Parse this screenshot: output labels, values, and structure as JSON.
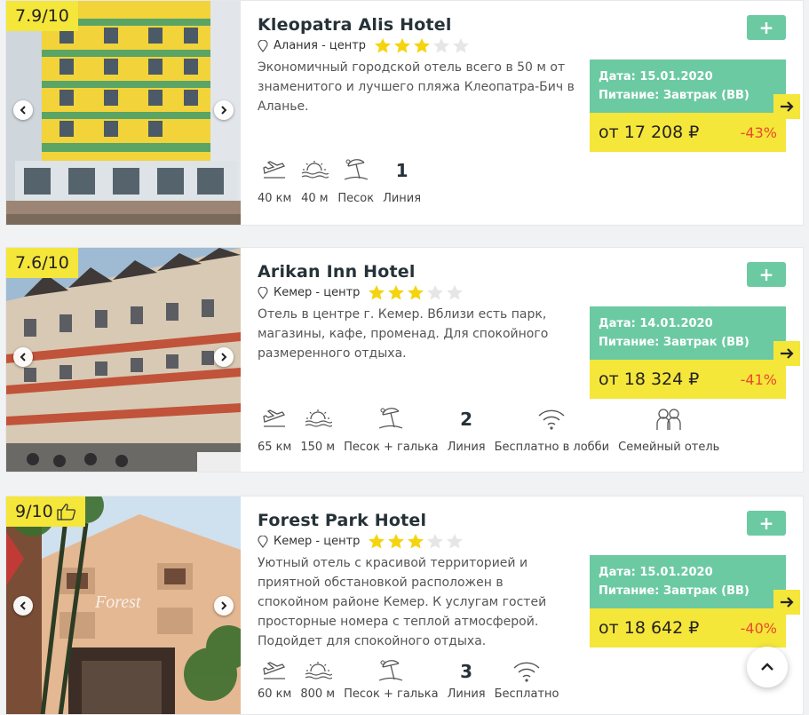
{
  "hotels": [
    {
      "rating": "7.9/10",
      "name": "Kleopatra Alis Hotel",
      "location": "Алания - центр",
      "stars": 3,
      "description": "Экономичный городской отель всего в 50 м от знаменитого и лучшего пляжа Клеопатра-Бич в Аланье.",
      "features": {
        "airport": "40 км",
        "beach": "40 м",
        "beach_type": "Песок",
        "line_num": "1",
        "line_label": "Линия"
      },
      "date": "Дата: 15.01.2020",
      "meal": "Питание: Завтрак (BB)",
      "price": "от 17 208 ₽",
      "discount": "-43%"
    },
    {
      "rating": "7.6/10",
      "name": "Arikan Inn Hotel",
      "location": "Кемер - центр",
      "stars": 3,
      "description": "Отель в центре г. Кемер. Вблизи есть парк, магазины, кафе, променад. Для спокойного размеренного отдыха.",
      "features": {
        "airport": "65 км",
        "beach": "150 м",
        "beach_type": "Песок + галька",
        "line_num": "2",
        "line_label": "Линия",
        "wifi": "Бесплатно в лобби",
        "family": "Семейный отель"
      },
      "date": "Дата: 14.01.2020",
      "meal": "Питание: Завтрак (BB)",
      "price": "от 18 324 ₽",
      "discount": "-41%"
    },
    {
      "rating": "9/10",
      "name": "Forest Park Hotel",
      "location": "Кемер - центр",
      "stars": 3,
      "description": "Уютный отель с красивой территорией и приятной обстановкой расположен в спокойном районе Кемер. К услугам гостей просторные номера с теплой атмосферой. Подойдет для спокойного отдыха.",
      "features": {
        "airport": "60 км",
        "beach": "800 м",
        "beach_type": "Песок + галька",
        "line_num": "3",
        "line_label": "Линия",
        "wifi": "Бесплатно"
      },
      "date": "Дата: 15.01.2020",
      "meal": "Питание: Завтрак (BB)",
      "price": "от 18 642 ₽",
      "discount": "-40%"
    }
  ],
  "add_label": "+",
  "colors": {
    "accent_green": "#6ccaa3",
    "accent_yellow": "#f5e63a",
    "discount_red": "#e84b2a",
    "star_yellow": "#f5d40f",
    "star_grey": "#e6e6e6"
  }
}
